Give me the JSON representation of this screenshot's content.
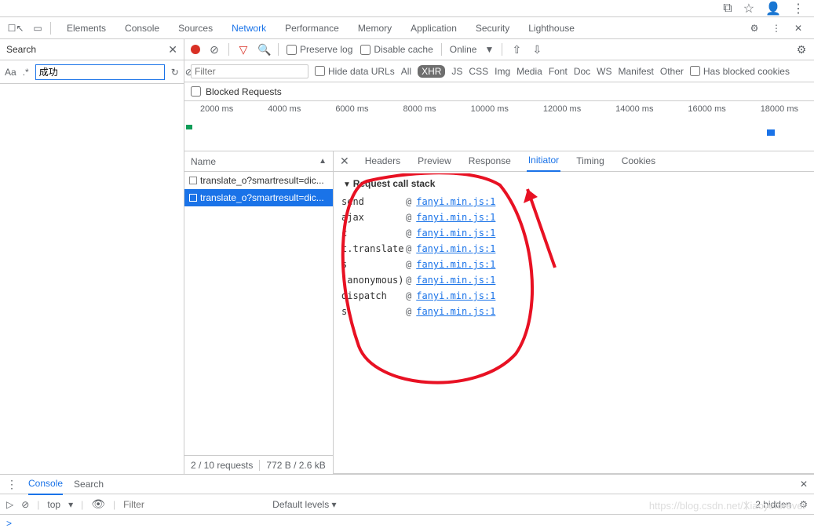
{
  "browser_toolbar": {
    "ext_icon": "⧉",
    "star": "☆",
    "user": "👤",
    "menu": "⋮"
  },
  "tabs": [
    "Elements",
    "Console",
    "Sources",
    "Network",
    "Performance",
    "Memory",
    "Application",
    "Security",
    "Lighthouse"
  ],
  "active_tab": "Network",
  "gear": "⚙",
  "more": "⋮",
  "close": "✕",
  "search_panel": {
    "title": "Search",
    "aa": "Aa",
    "regex": ".*",
    "value": "成功",
    "refresh": "↻",
    "cancel": "⊘"
  },
  "toolbar": {
    "clear": "⊘",
    "filter": "▽",
    "search": "🔍",
    "preserve": "Preserve log",
    "disable": "Disable cache",
    "online": "Online",
    "caret": "▼",
    "up": "⇧",
    "down": "⇩",
    "gear": "⚙"
  },
  "filter_row": {
    "placeholder": "Filter",
    "hide": "Hide data URLs",
    "types": [
      "All",
      "XHR",
      "JS",
      "CSS",
      "Img",
      "Media",
      "Font",
      "Doc",
      "WS",
      "Manifest",
      "Other"
    ],
    "active": "XHR",
    "blocked": "Has blocked cookies"
  },
  "blocked_row": {
    "label": "Blocked Requests"
  },
  "timeline": {
    "ticks": [
      "2000 ms",
      "4000 ms",
      "6000 ms",
      "8000 ms",
      "10000 ms",
      "12000 ms",
      "14000 ms",
      "16000 ms",
      "18000 ms"
    ]
  },
  "req_header": {
    "name": "Name",
    "tri": "▲"
  },
  "requests": [
    {
      "label": "translate_o?smartresult=dic...",
      "selected": false
    },
    {
      "label": "translate_o?smartresult=dic...",
      "selected": true
    }
  ],
  "req_footer": {
    "count": "2 / 10 requests",
    "size": "772 B / 2.6 kB"
  },
  "detail_tabs": [
    "Headers",
    "Preview",
    "Response",
    "Initiator",
    "Timing",
    "Cookies"
  ],
  "detail_active": "Initiator",
  "stack": {
    "title": "Request call stack",
    "rows": [
      {
        "fn": "send",
        "link": "fanyi.min.js:1"
      },
      {
        "fn": "ajax",
        "link": "fanyi.min.js:1"
      },
      {
        "fn": "c",
        "link": "fanyi.min.js:1"
      },
      {
        "fn": "t.translate",
        "link": "fanyi.min.js:1"
      },
      {
        "fn": "s",
        "link": "fanyi.min.js:1"
      },
      {
        "fn": "(anonymous)",
        "link": "fanyi.min.js:1"
      },
      {
        "fn": "dispatch",
        "link": "fanyi.min.js:1"
      },
      {
        "fn": "s",
        "link": "fanyi.min.js:1"
      }
    ],
    "at": "@"
  },
  "drawer": {
    "tabs": [
      "Console",
      "Search"
    ],
    "active": "Console",
    "run": "▷",
    "cancel": "⊘",
    "context": "top",
    "eye": "👁",
    "filter_placeholder": "Filter",
    "levels": "Default levels ▾",
    "hidden": "2 hidden",
    "gear": "⚙",
    "close": "✕",
    "prompt": ">"
  },
  "watermark": "https://blog.csdn.net/Xiaoyeforever"
}
